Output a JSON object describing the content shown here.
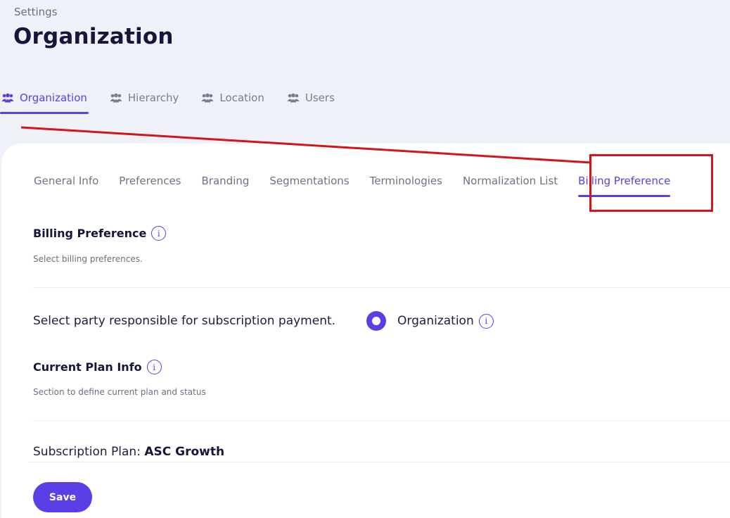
{
  "header": {
    "breadcrumb": "Settings",
    "title": "Organization"
  },
  "top_tabs": [
    {
      "label": "Organization",
      "icon": "users-icon",
      "active": true
    },
    {
      "label": "Hierarchy",
      "icon": "users-icon",
      "active": false
    },
    {
      "label": "Location",
      "icon": "users-icon",
      "active": false
    },
    {
      "label": "Users",
      "icon": "users-icon",
      "active": false
    }
  ],
  "sub_tabs": [
    {
      "label": "General Info",
      "active": false
    },
    {
      "label": "Preferences",
      "active": false
    },
    {
      "label": "Branding",
      "active": false
    },
    {
      "label": "Segmentations",
      "active": false
    },
    {
      "label": "Terminologies",
      "active": false
    },
    {
      "label": "Normalization List",
      "active": false
    },
    {
      "label": "Billing Preference",
      "active": true
    }
  ],
  "billing": {
    "title": "Billing Preference",
    "description": "Select billing preferences.",
    "party_label": "Select party responsible for subscription payment.",
    "option_label": "Organization",
    "option_selected": true
  },
  "plan": {
    "title": "Current Plan Info",
    "description": "Section to define current plan and status",
    "subscription_label": "Subscription Plan:",
    "subscription_value": "ASC Growth"
  },
  "footer": {
    "save_label": "Save"
  },
  "colors": {
    "accent": "#5b3ee6",
    "annotation": "#d4141b",
    "background": "#eef1f8"
  }
}
